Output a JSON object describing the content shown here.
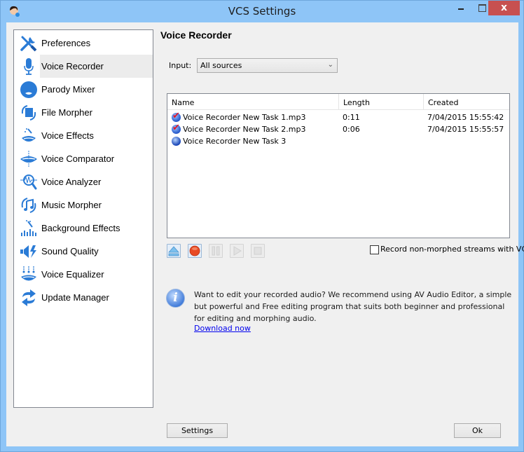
{
  "window": {
    "title": "VCS Settings",
    "close_label": "x"
  },
  "sidebar": {
    "selected": "Voice Recorder",
    "items": [
      {
        "label": "Preferences",
        "icon": "wrench-screwdriver-icon"
      },
      {
        "label": "Voice Recorder",
        "icon": "microphone-icon"
      },
      {
        "label": "Parody Mixer",
        "icon": "face-mask-icon"
      },
      {
        "label": "File Morpher",
        "icon": "file-morph-icon"
      },
      {
        "label": "Voice Effects",
        "icon": "lips-wand-icon"
      },
      {
        "label": "Voice Comparator",
        "icon": "lips-compare-icon"
      },
      {
        "label": "Voice Analyzer",
        "icon": "waveform-magnifier-icon"
      },
      {
        "label": "Music Morpher",
        "icon": "music-note-icon"
      },
      {
        "label": "Background Effects",
        "icon": "equalizer-wand-icon"
      },
      {
        "label": "Sound Quality",
        "icon": "speaker-bolt-icon"
      },
      {
        "label": "Voice Equalizer",
        "icon": "lips-sliders-icon"
      },
      {
        "label": "Update Manager",
        "icon": "refresh-arrows-icon"
      }
    ]
  },
  "main": {
    "heading": "Voice Recorder",
    "input_label": "Input:",
    "input_value": "All sources",
    "table": {
      "columns": [
        "Name",
        "Length",
        "Created"
      ],
      "rows": [
        {
          "status": "checked",
          "name": "Voice Recorder New Task 1.mp3",
          "length": "0:11",
          "created": "7/04/2015 15:55:42"
        },
        {
          "status": "checked",
          "name": "Voice Recorder New Task 2.mp3",
          "length": "0:06",
          "created": "7/04/2015 15:55:57"
        },
        {
          "status": "pending",
          "name": "Voice Recorder New Task 3",
          "length": "",
          "created": ""
        }
      ]
    },
    "toolbar": [
      {
        "name": "eject",
        "enabled": true
      },
      {
        "name": "record",
        "enabled": true
      },
      {
        "name": "pause",
        "enabled": false
      },
      {
        "name": "play",
        "enabled": false
      },
      {
        "name": "stop",
        "enabled": false
      }
    ],
    "record_nonmorphed_label": "Record non-morphed streams with VCS",
    "record_nonmorphed_checked": false,
    "info_text": "Want to edit your recorded audio? We recommend using AV Audio Editor, a simple but powerful and Free editing program that suits both beginner and professional for editing and morphing audio.",
    "info_link": "Download now"
  },
  "footer": {
    "settings_label": "Settings",
    "ok_label": "Ok"
  },
  "colors": {
    "frame": "#8ec5f7",
    "close": "#c75050",
    "icon_blue": "#2a7bd6",
    "link": "#0000ee"
  }
}
